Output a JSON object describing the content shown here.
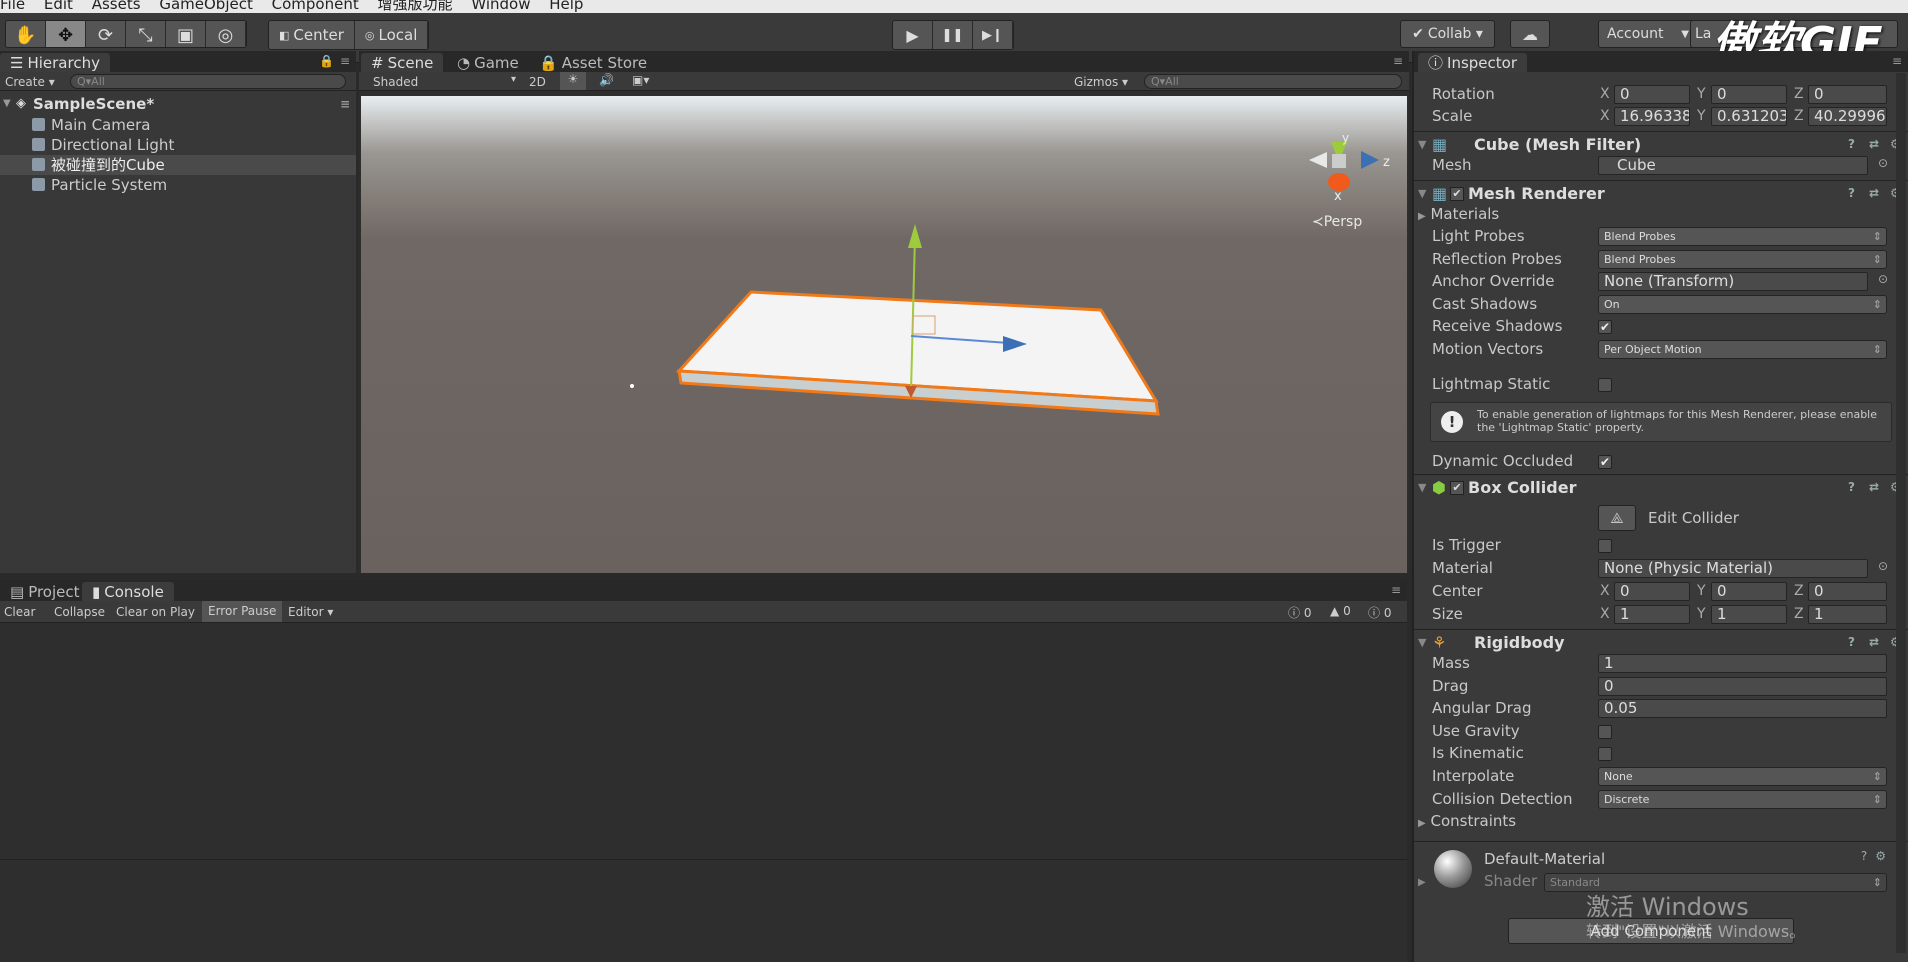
{
  "menu": [
    "File",
    "Edit",
    "Assets",
    "GameObject",
    "Component",
    "增强版功能",
    "Window",
    "Help"
  ],
  "toolbar": {
    "tools": [
      "✋",
      "✥",
      "⟳",
      "⤡",
      "▣",
      "◎"
    ],
    "pivot": "Center",
    "space": "Local",
    "play_icons": [
      "▶",
      "❚❚",
      "▶❙"
    ],
    "collab": "Collab ▾",
    "account": "Account",
    "layers": "La",
    "watermark": "傲软GIF"
  },
  "hierarchy": {
    "tab": "Hierarchy",
    "create": "Create ▾",
    "search_placeholder": "Q▾All",
    "scene": "SampleScene*",
    "items": [
      "Main Camera",
      "Directional Light",
      "被碰撞到的Cube",
      "Particle System"
    ]
  },
  "scene": {
    "tabs": [
      "Scene",
      "Game",
      "Asset Store"
    ],
    "shading": "Shaded",
    "mode2d": "2D",
    "gizmos": "Gizmos ▾",
    "search_placeholder": "Q▾All",
    "persp": "≺Persp",
    "axis_x": "x",
    "axis_y": "y",
    "axis_z": "z"
  },
  "console": {
    "tabs": [
      "Project",
      "Console"
    ],
    "buttons": [
      "Clear",
      "Collapse",
      "Clear on Play",
      "Error Pause",
      "Editor ▾"
    ],
    "counts": [
      "0",
      "0",
      "0"
    ]
  },
  "inspector": {
    "tab": "Inspector",
    "rotation": {
      "label": "Rotation",
      "x": "0",
      "y": "0",
      "z": "0"
    },
    "scale": {
      "label": "Scale",
      "x": "16.96338",
      "y": "0.631203",
      "z": "40.29996"
    },
    "mesh_filter": {
      "title": "Cube (Mesh Filter)",
      "mesh_label": "Mesh",
      "mesh_value": "Cube"
    },
    "mesh_renderer": {
      "title": "Mesh Renderer",
      "materials": "Materials",
      "light_probes": {
        "label": "Light Probes",
        "value": "Blend Probes"
      },
      "reflection_probes": {
        "label": "Reflection Probes",
        "value": "Blend Probes"
      },
      "anchor_override": {
        "label": "Anchor Override",
        "value": "None (Transform)"
      },
      "cast_shadows": {
        "label": "Cast Shadows",
        "value": "On"
      },
      "receive_shadows": {
        "label": "Receive Shadows",
        "checked": true
      },
      "motion_vectors": {
        "label": "Motion Vectors",
        "value": "Per Object Motion"
      },
      "lightmap_static": {
        "label": "Lightmap Static",
        "checked": false
      },
      "info": "To enable generation of lightmaps for this Mesh Renderer, please enable the 'Lightmap Static' property.",
      "dynamic_occluded": {
        "label": "Dynamic Occluded",
        "checked": true
      }
    },
    "box_collider": {
      "title": "Box Collider",
      "edit": "Edit Collider",
      "is_trigger": {
        "label": "Is Trigger",
        "checked": false
      },
      "material": {
        "label": "Material",
        "value": "None (Physic Material)"
      },
      "center": {
        "label": "Center",
        "x": "0",
        "y": "0",
        "z": "0"
      },
      "size": {
        "label": "Size",
        "x": "1",
        "y": "1",
        "z": "1"
      }
    },
    "rigidbody": {
      "title": "Rigidbody",
      "mass": {
        "label": "Mass",
        "value": "1"
      },
      "drag": {
        "label": "Drag",
        "value": "0"
      },
      "angular_drag": {
        "label": "Angular Drag",
        "value": "0.05"
      },
      "use_gravity": {
        "label": "Use Gravity",
        "checked": false
      },
      "is_kinematic": {
        "label": "Is Kinematic",
        "checked": false
      },
      "interpolate": {
        "label": "Interpolate",
        "value": "None"
      },
      "collision": {
        "label": "Collision Detection",
        "value": "Discrete"
      },
      "constraints": "Constraints"
    },
    "material": {
      "name": "Default-Material",
      "shader_label": "Shader",
      "shader_value": "Standard"
    },
    "add_component": "Add Component",
    "activate_line1": "激活 Windows",
    "activate_line2": "转到\"设置\"以激活 Windows。"
  },
  "colors": {
    "selection": "#f07a1a",
    "accent": "#3d6fb5",
    "bg": "#383838"
  }
}
